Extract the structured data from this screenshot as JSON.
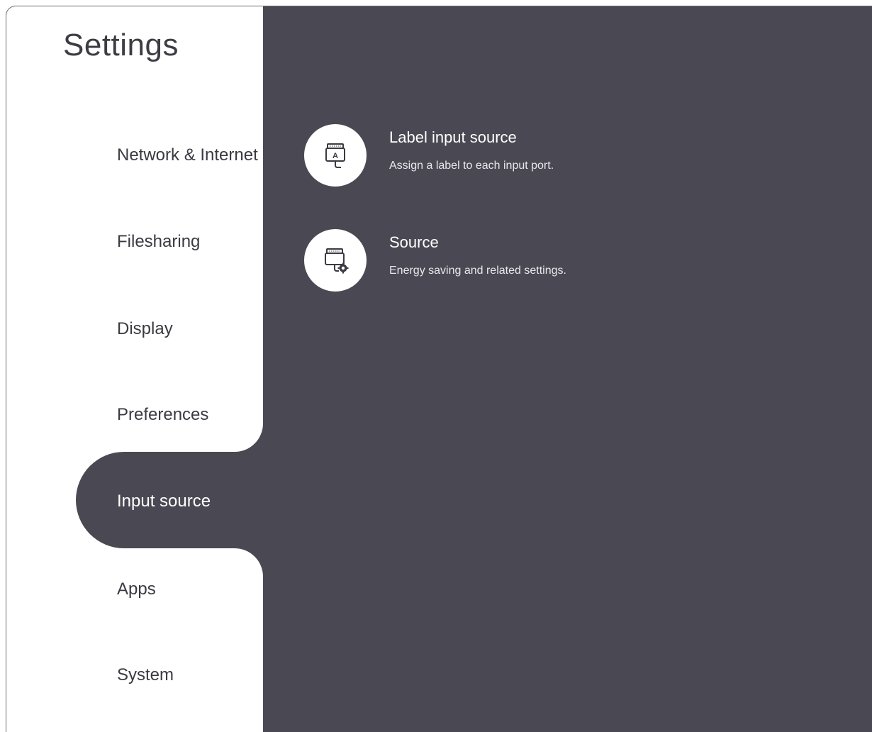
{
  "page": {
    "title": "Settings"
  },
  "colors": {
    "panel": "#4a4953",
    "sidebar": "#ffffff",
    "nav_text": "#3a3a42",
    "selected_text": "#ffffff"
  },
  "sidebar": {
    "items": [
      {
        "label": "Network & Internet",
        "selected": false
      },
      {
        "label": "Filesharing",
        "selected": false
      },
      {
        "label": "Display",
        "selected": false
      },
      {
        "label": "Preferences",
        "selected": false
      },
      {
        "label": "Input source",
        "selected": true
      },
      {
        "label": "Apps",
        "selected": false
      },
      {
        "label": "System",
        "selected": false
      }
    ]
  },
  "main": {
    "options": [
      {
        "title": "Label input source",
        "description": "Assign a label to each input port.",
        "icon": "label-port-icon"
      },
      {
        "title": "Source",
        "description": "Energy saving and related settings.",
        "icon": "port-settings-icon"
      }
    ]
  }
}
